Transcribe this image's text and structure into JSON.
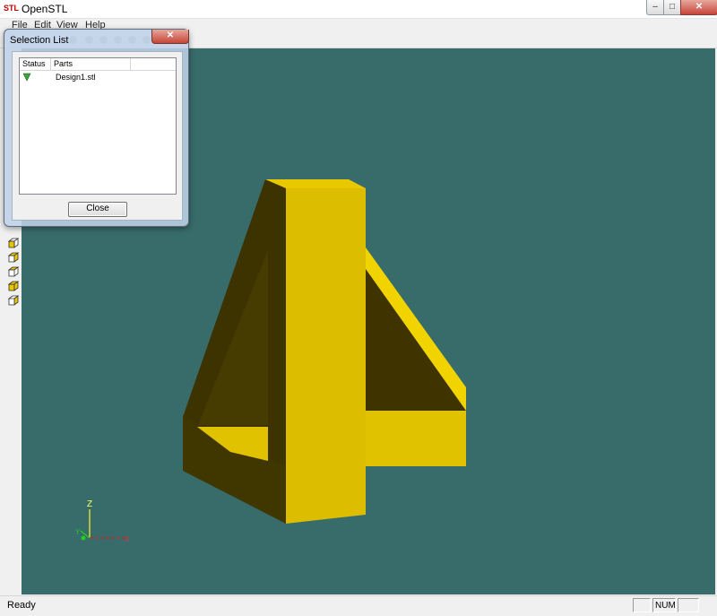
{
  "window": {
    "logo": "STL",
    "title": "OpenSTL",
    "controls": {
      "minimize": "–",
      "maximize": "□",
      "close": "✕"
    }
  },
  "menu": [
    "File",
    "Edit",
    "View",
    "Help"
  ],
  "viewport": {
    "background": "#386c6b",
    "model_color": "#e1c200",
    "axes": {
      "z_label": "Z",
      "x_label": "X",
      "y_label": "Y"
    }
  },
  "selection_dialog": {
    "title": "Selection List",
    "close_glyph": "✕",
    "columns": [
      "Status",
      "Parts"
    ],
    "rows": [
      {
        "status_icon": "green-flag-icon",
        "part": "Design1.stl"
      }
    ],
    "close_button": "Close"
  },
  "statusbar": {
    "ready": "Ready",
    "num": "NUM"
  }
}
